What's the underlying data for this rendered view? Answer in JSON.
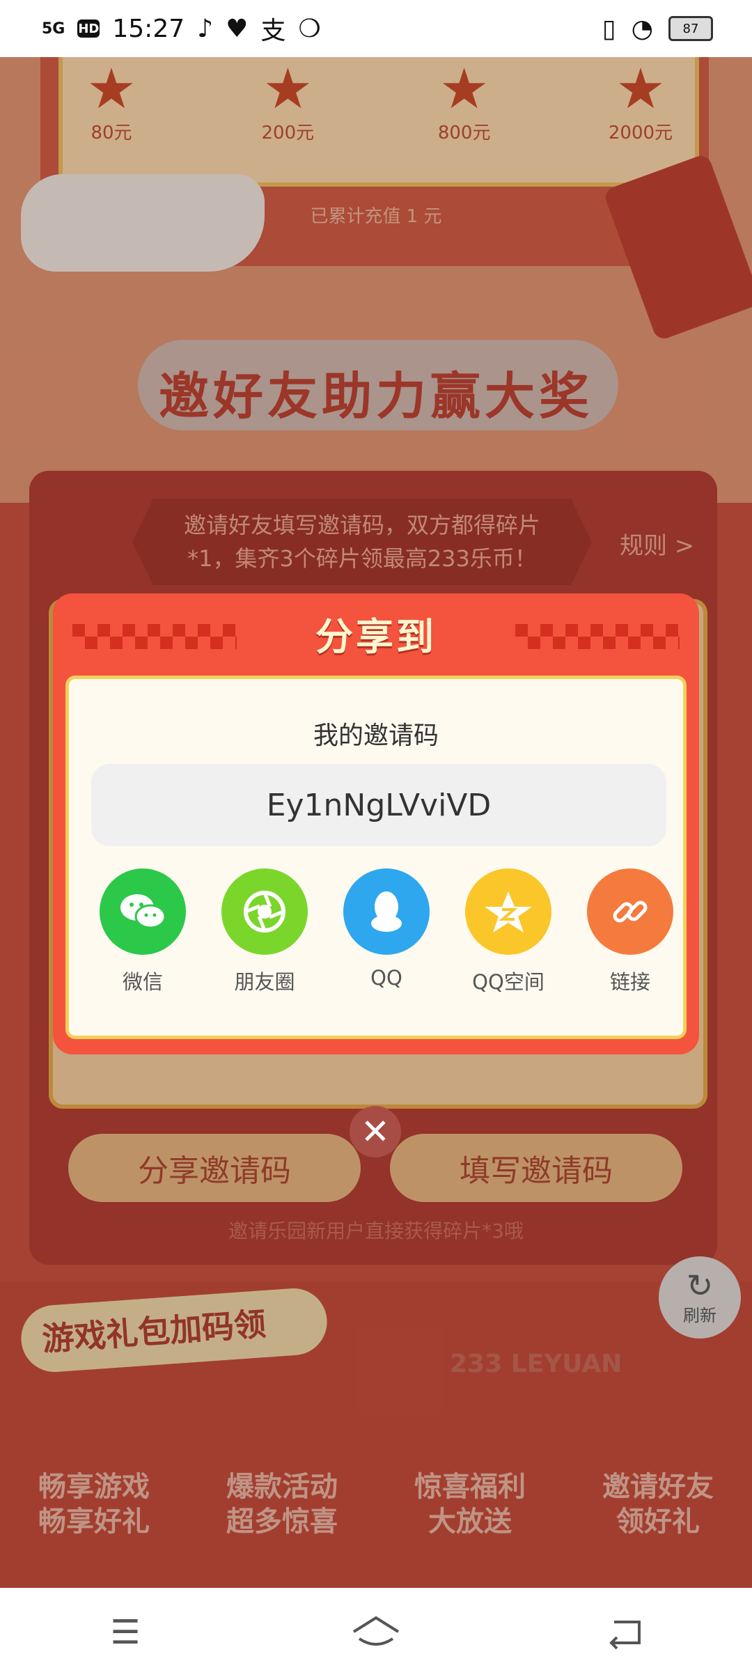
{
  "status": {
    "time": "15:27",
    "signal": "5G",
    "hd": "HD",
    "battery": "87"
  },
  "background": {
    "prizes": [
      "80元",
      "200元",
      "800元",
      "2000元"
    ],
    "recharge_text": "已累计充值 1 元",
    "section_title": "邀好友助力赢大奖",
    "rule_text_line1": "邀请好友填写邀请码，双方都得碎片",
    "rule_text_line2": "*1，集齐3个碎片领最高233乐币！",
    "rule_link": "规则 >",
    "share_code_button": "分享邀请码",
    "fill_code_button": "填写邀请码",
    "hint": "邀请乐园新用户直接获得碎片*3哦",
    "gift_label": "游戏礼包加码领",
    "leyuan": "233 LEYUAN",
    "features": [
      {
        "line1": "畅享游戏",
        "line2": "畅享好礼"
      },
      {
        "line1": "爆款活动",
        "line2": "超多惊喜"
      },
      {
        "line1": "惊喜福利",
        "line2": "大放送"
      },
      {
        "line1": "邀请好友",
        "line2": "领好礼"
      }
    ],
    "refresh": "刷新"
  },
  "modal": {
    "title": "分享到",
    "code_label": "我的邀请码",
    "invite_code": "Ey1nNgLVviVD",
    "targets": [
      {
        "label": "微信",
        "color": "#2cc84a",
        "icon": "wechat-icon"
      },
      {
        "label": "朋友圈",
        "color": "#7bd62c",
        "icon": "moments-icon"
      },
      {
        "label": "QQ",
        "color": "#2ea7ee",
        "icon": "qq-icon"
      },
      {
        "label": "QQ空间",
        "color": "#fbc629",
        "icon": "qzone-icon"
      },
      {
        "label": "链接",
        "color": "#f57a3e",
        "icon": "link-icon"
      }
    ]
  }
}
